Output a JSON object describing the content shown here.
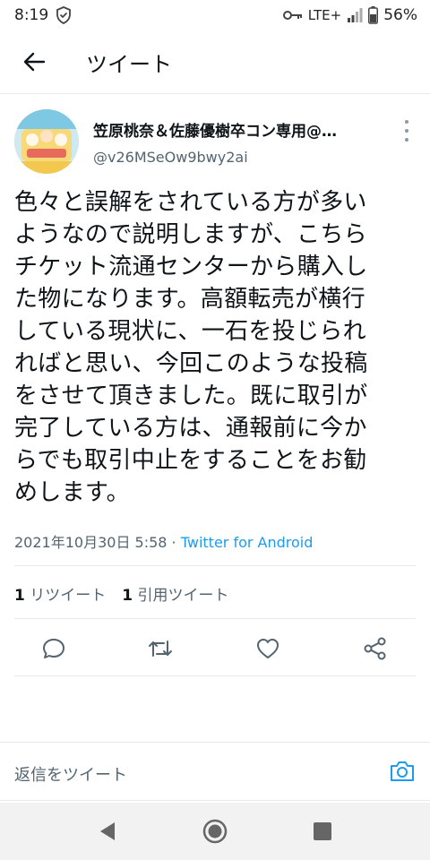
{
  "status_bar": {
    "time": "8:19",
    "network": "LTE+",
    "battery": "56%",
    "icons": [
      "shield-icon",
      "key-icon",
      "signal-icon",
      "battery-icon"
    ]
  },
  "header": {
    "title": "ツイート",
    "back_icon": "arrow-left-icon"
  },
  "tweet": {
    "author_name": "笠原桃奈＆佐藤優樹卒コン専用@…",
    "author_handle": "@v26MSeOw9bwy2ai",
    "text": "色々と誤解をされている方が多い\nようなので説明しますが、こちら\nチケット流通センターから購入し\nた物になります。高額転売が横行\nしている現状に、一石を投じられ\nればと思い、今回このような投稿\nをさせて頂きました。既に取引が\n完了している方は、通報前に今か\nらでも取引中止をすることをお勧\nめします。",
    "timestamp": "2021年10月30日 5:58",
    "separator": " · ",
    "source": "Twitter for Android"
  },
  "stats": {
    "retweets_count": "1",
    "retweets_label": "リツイート",
    "quotes_count": "1",
    "quotes_label": "引用ツイート"
  },
  "actions": [
    "reply-icon",
    "retweet-icon",
    "like-icon",
    "share-icon"
  ],
  "reply": {
    "placeholder": "返信をツイート",
    "camera_icon": "camera-icon"
  },
  "navigation": [
    "back-triangle-icon",
    "home-circle-icon",
    "recents-square-icon"
  ],
  "colors": {
    "accent": "#1d9bf0",
    "text_primary": "#0f1419",
    "text_secondary": "#536471",
    "divider": "#e7e9ea"
  }
}
